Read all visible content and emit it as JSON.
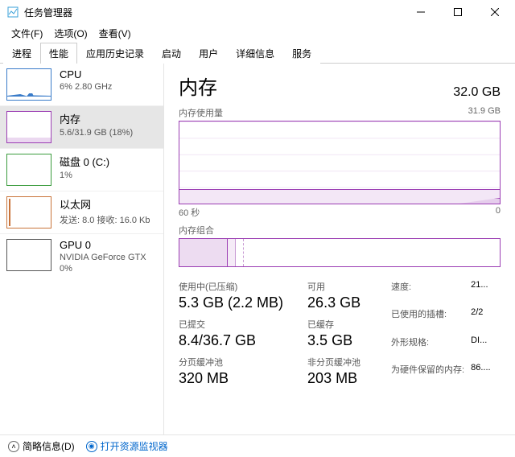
{
  "window": {
    "title": "任务管理器"
  },
  "menu": {
    "file": "文件(F)",
    "options": "选项(O)",
    "view": "查看(V)"
  },
  "tabs": {
    "processes": "进程",
    "performance": "性能",
    "app_history": "应用历史记录",
    "startup": "启动",
    "users": "用户",
    "details": "详细信息",
    "services": "服务"
  },
  "sidebar": {
    "cpu": {
      "title": "CPU",
      "sub": "6% 2.80 GHz"
    },
    "memory": {
      "title": "内存",
      "sub": "5.6/31.9 GB (18%)"
    },
    "disk": {
      "title": "磁盘 0 (C:)",
      "sub": "1%"
    },
    "eth": {
      "title": "以太网",
      "sub": "发送: 8.0 接收: 16.0 Kb"
    },
    "gpu": {
      "title": "GPU 0",
      "sub": "NVIDIA GeForce GTX",
      "sub2": "0%"
    }
  },
  "main": {
    "title": "内存",
    "total": "32.0 GB",
    "usage_label": "内存使用量",
    "usage_max": "31.9 GB",
    "axis_left": "60 秒",
    "axis_right": "0",
    "composition_label": "内存组合"
  },
  "stats": {
    "in_use": {
      "label": "使用中(已压缩)",
      "value": "5.3 GB (2.2 MB)"
    },
    "available": {
      "label": "可用",
      "value": "26.3 GB"
    },
    "committed": {
      "label": "已提交",
      "value": "8.4/36.7 GB"
    },
    "cached": {
      "label": "已缓存",
      "value": "3.5 GB"
    },
    "paged": {
      "label": "分页缓冲池",
      "value": "320 MB"
    },
    "nonpaged": {
      "label": "非分页缓冲池",
      "value": "203 MB"
    }
  },
  "info": {
    "speed_label": "速度:",
    "speed": "21...",
    "slots_label": "已使用的插槽:",
    "slots": "2/2",
    "form_label": "外形规格:",
    "form": "DI...",
    "reserved_label": "为硬件保留的内存:",
    "reserved": "86...."
  },
  "footer": {
    "fewer": "简略信息(D)",
    "open_monitor": "打开资源监视器"
  },
  "chart_data": {
    "type": "area",
    "title": "内存使用量",
    "xlabel": "60 秒",
    "ylim": [
      0,
      31.9
    ],
    "yunit": "GB",
    "series": [
      {
        "name": "使用中",
        "approx_value": 5.6,
        "note": "flat line near 18% with small uptick at right edge"
      }
    ],
    "composition": {
      "in_use_gb": 5.3,
      "modified_gb": 0.3,
      "standby_gb": 3.5,
      "free_gb": 22.8,
      "total_gb": 31.9
    }
  }
}
